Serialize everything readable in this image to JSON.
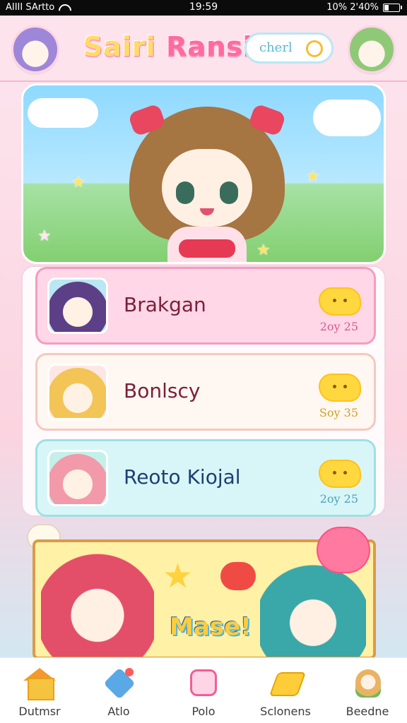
{
  "status_bar": {
    "carrier": "AIIII SArtto",
    "time": "19:59",
    "battery_text": "10% 2'40%"
  },
  "header": {
    "title_part1": "Sairi",
    "title_part2": "Ransi",
    "search_text": "cherl"
  },
  "list": {
    "items": [
      {
        "name": "Brakgan",
        "meta": "2oy 25"
      },
      {
        "name": "Bonlscy",
        "meta": "Soy 35"
      },
      {
        "name": "Reoto Kiojal",
        "meta": "2oy 25"
      }
    ]
  },
  "illustration": {
    "word": "Mase!"
  },
  "nav": {
    "items": [
      {
        "label": "Dutmsr",
        "icon": "home-icon"
      },
      {
        "label": "Atlo",
        "icon": "tag-icon"
      },
      {
        "label": "Polo",
        "icon": "book-icon"
      },
      {
        "label": "Sclonens",
        "icon": "pencil-icon"
      },
      {
        "label": "Beedne",
        "icon": "profile-icon"
      }
    ]
  },
  "colors": {
    "accent_pink": "#ff6b9f",
    "title_yellow": "#ffdb6b",
    "nav_bg": "#ffffff"
  }
}
